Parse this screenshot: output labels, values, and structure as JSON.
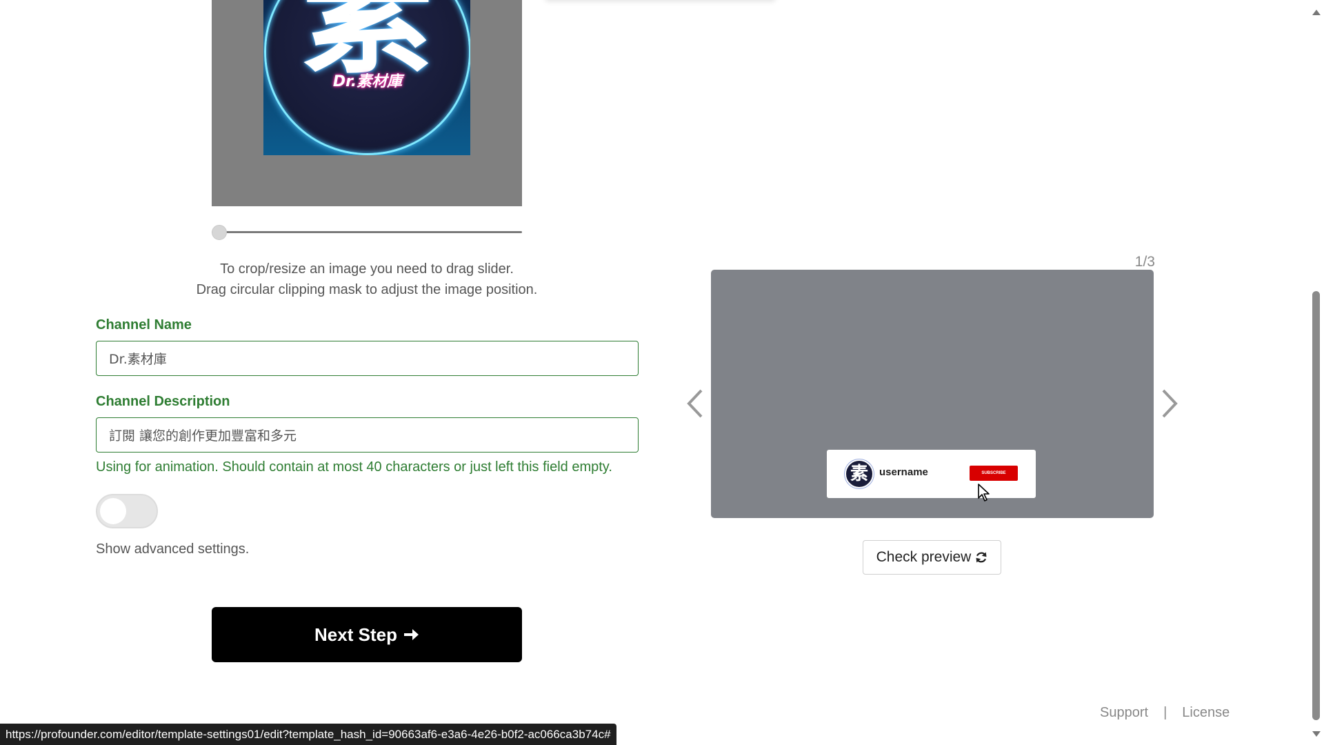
{
  "logo": {
    "character": "素",
    "brand_text": "Dr.素材庫"
  },
  "crop_slider": {
    "value": 0
  },
  "crop_hint": {
    "line1": "To crop/resize an image you need to drag slider.",
    "line2": "Drag circular clipping mask to adjust the image position."
  },
  "channel_name": {
    "label": "Channel Name",
    "value": "Dr.素材庫"
  },
  "channel_description": {
    "label": "Channel Description",
    "value": "訂閱 讓您的創作更加豐富和多元",
    "help": "Using for animation. Should contain at most 40 characters or just left this field empty."
  },
  "advanced_settings": {
    "enabled": false,
    "label": "Show advanced settings."
  },
  "next_step": {
    "label": "Next Step"
  },
  "preview": {
    "counter": "1/3",
    "avatar_char": "素",
    "username": "username",
    "subscribe_label": "SUBSCRIBE",
    "check_preview_label": "Check preview",
    "background_color": "#808389"
  },
  "footer": {
    "support": "Support",
    "separator": "|",
    "license": "License"
  },
  "status_bar": {
    "url": "https://profounder.com/editor/template-settings01/edit?template_hash_id=90663af6-e3a6-4e26-b0f2-ac066ca3b74c#"
  },
  "colors": {
    "label_green": "#2e7d32",
    "button_black": "#000000",
    "subscribe_red": "#d80000"
  }
}
